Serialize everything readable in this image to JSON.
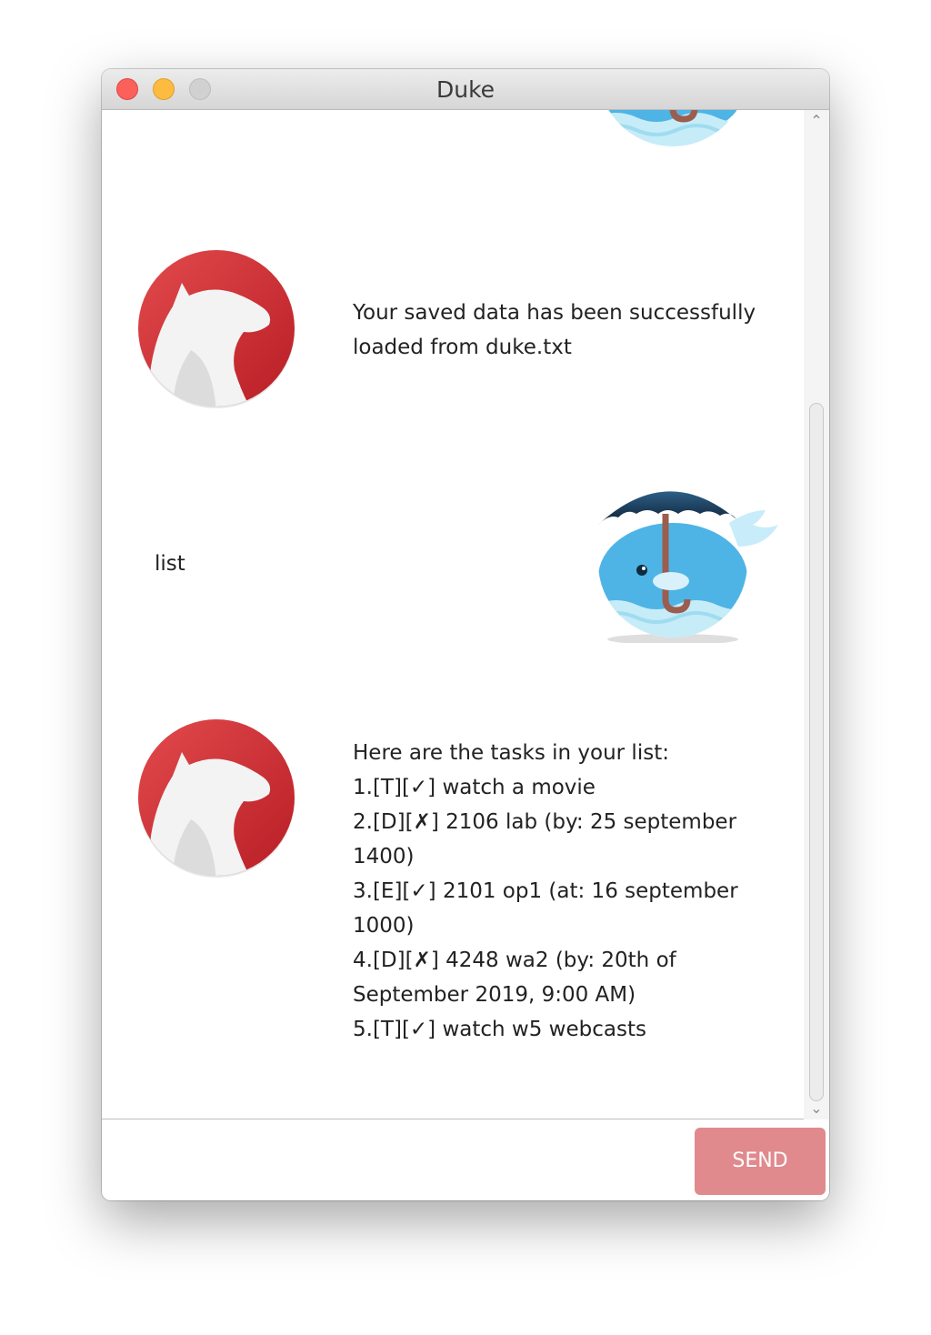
{
  "window": {
    "title": "Duke"
  },
  "chat": {
    "messages": [
      {
        "sender": "duke",
        "lines": [
          "Your saved data has been successfully",
          "loaded from duke.txt"
        ]
      },
      {
        "sender": "user",
        "lines": [
          "list"
        ]
      },
      {
        "sender": "duke",
        "lines": [
          "Here are the tasks in your list:",
          "1.[T][✓] watch a movie",
          "2.[D][✗] 2106 lab (by: 25 september",
          "1400)",
          "3.[E][✓] 2101 op1 (at: 16 september",
          "1000)",
          "4.[D][✗] 4248 wa2 (by: 20th of",
          "September 2019, 9:00 AM)",
          "5.[T][✓] watch w5 webcasts"
        ]
      }
    ]
  },
  "input": {
    "value": "",
    "placeholder": ""
  },
  "send_button": {
    "label": "SEND"
  },
  "icons": {
    "duke_avatar": "red-bear-icon",
    "user_avatar": "whale-umbrella-icon"
  },
  "colors": {
    "send_button": "#e08a8d",
    "duke_avatar": "#d93a3f",
    "user_avatar": "#4eb4e6",
    "close": "#fc605b",
    "minimize": "#fdbc40"
  }
}
